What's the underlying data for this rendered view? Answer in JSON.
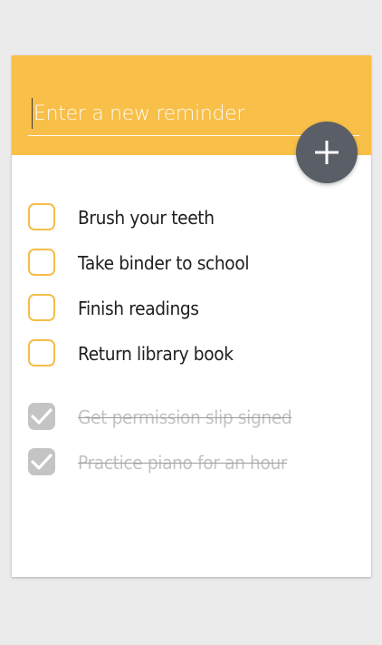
{
  "input": {
    "placeholder": "Enter a new reminder",
    "value": ""
  },
  "add_button": {
    "icon": "plus-icon"
  },
  "colors": {
    "header": "#f8bf49",
    "fab": "#5a5e66",
    "checkbox_open": "#f5bd48",
    "checkbox_done": "#c4c4c4",
    "text": "#1e1e1e",
    "text_done": "#c3c3c3"
  },
  "reminders": [
    {
      "label": "Brush your teeth",
      "done": false
    },
    {
      "label": "Take binder to school",
      "done": false
    },
    {
      "label": "Finish readings",
      "done": false
    },
    {
      "label": "Return library book",
      "done": false
    }
  ],
  "completed": [
    {
      "label": "Get permission slip signed",
      "done": true
    },
    {
      "label": "Practice piano for an hour",
      "done": true
    }
  ]
}
